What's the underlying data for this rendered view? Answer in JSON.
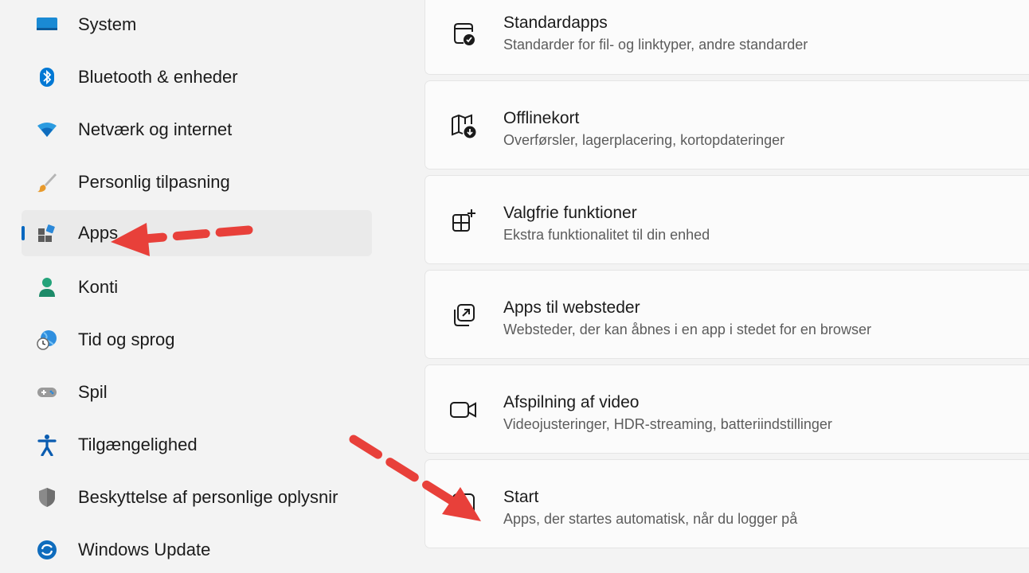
{
  "sidebar": {
    "items": [
      {
        "label": "System",
        "icon": "monitor-icon"
      },
      {
        "label": "Bluetooth & enheder",
        "icon": "bluetooth-icon"
      },
      {
        "label": "Netværk og internet",
        "icon": "wifi-icon"
      },
      {
        "label": "Personlig tilpasning",
        "icon": "paintbrush-icon"
      },
      {
        "label": "Apps",
        "icon": "apps-icon",
        "selected": true
      },
      {
        "label": "Konti",
        "icon": "person-icon"
      },
      {
        "label": "Tid og sprog",
        "icon": "globe-clock-icon"
      },
      {
        "label": "Spil",
        "icon": "gamepad-icon"
      },
      {
        "label": "Tilgængelighed",
        "icon": "accessibility-icon"
      },
      {
        "label": "Beskyttelse af personlige oplysnir",
        "icon": "shield-icon"
      },
      {
        "label": "Windows Update",
        "icon": "update-icon"
      }
    ]
  },
  "cards": [
    {
      "title": "Standardapps",
      "subtitle": "Standarder for fil- og linktyper, andre standarder",
      "icon": "default-apps-icon"
    },
    {
      "title": "Offlinekort",
      "subtitle": "Overførsler, lagerplacering, kortopdateringer",
      "icon": "offline-map-icon"
    },
    {
      "title": "Valgfrie funktioner",
      "subtitle": "Ekstra funktionalitet til din enhed",
      "icon": "optional-features-icon"
    },
    {
      "title": "Apps til websteder",
      "subtitle": "Websteder, der kan åbnes i en app i stedet for en browser",
      "icon": "open-external-icon"
    },
    {
      "title": "Afspilning af video",
      "subtitle": "Videojusteringer, HDR-streaming, batteriindstillinger",
      "icon": "video-camera-icon"
    },
    {
      "title": "Start",
      "subtitle": "Apps, der startes automatisk, når du logger på",
      "icon": "startup-icon"
    }
  ],
  "colors": {
    "accent": "#0067c0",
    "annotation_arrow": "#e8403a"
  }
}
